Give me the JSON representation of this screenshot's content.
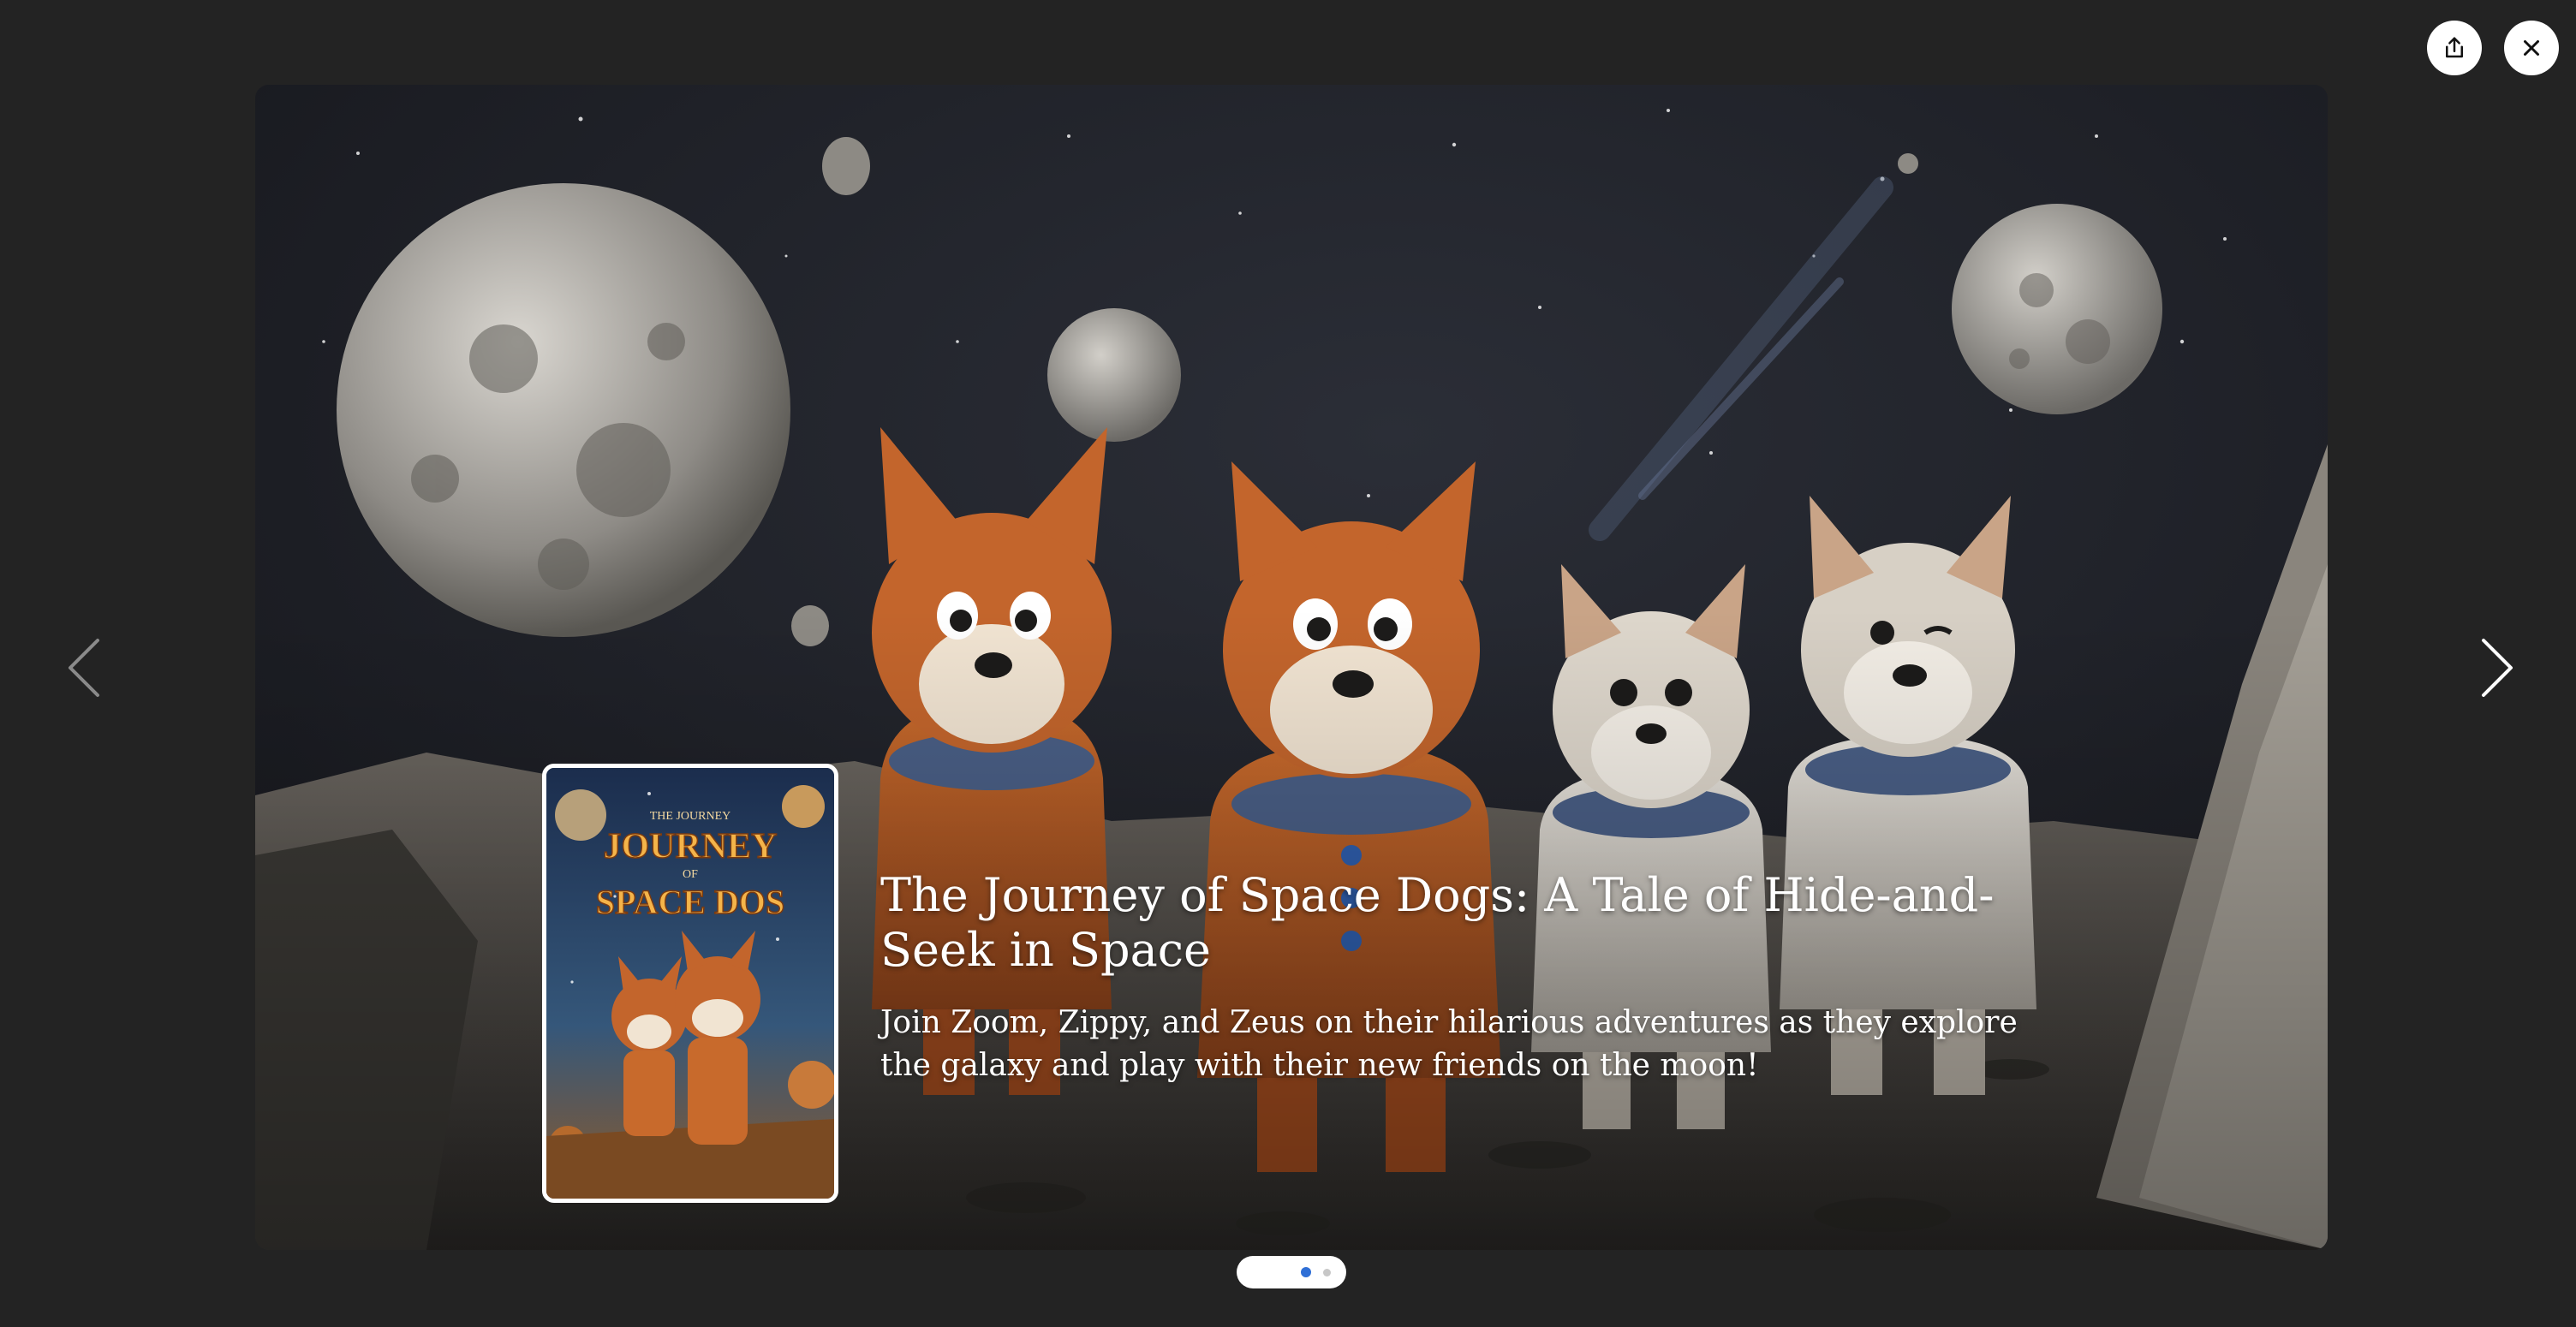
{
  "toolbar": {
    "share_icon": "share-icon",
    "close_icon": "close-icon"
  },
  "navigation": {
    "prev_icon": "chevron-left-icon",
    "next_icon": "chevron-right-icon"
  },
  "slide": {
    "title": "The Journey of Space Dogs: A Tale of Hide-and-Seek in Space",
    "description": "Join Zoom, Zippy, and Zeus on their hilarious adventures as they explore the galaxy and play with their new friends on the moon!",
    "cover": {
      "line1": "THE JOURNEY",
      "line2": "JOURNEY",
      "line3": "OF",
      "line4": "SPACE DOS"
    }
  },
  "pagination": {
    "count": 2,
    "active_index": 0
  },
  "colors": {
    "background": "#232323",
    "dot_active": "#2f6fd6",
    "dot_inactive": "#c7c7c7"
  }
}
